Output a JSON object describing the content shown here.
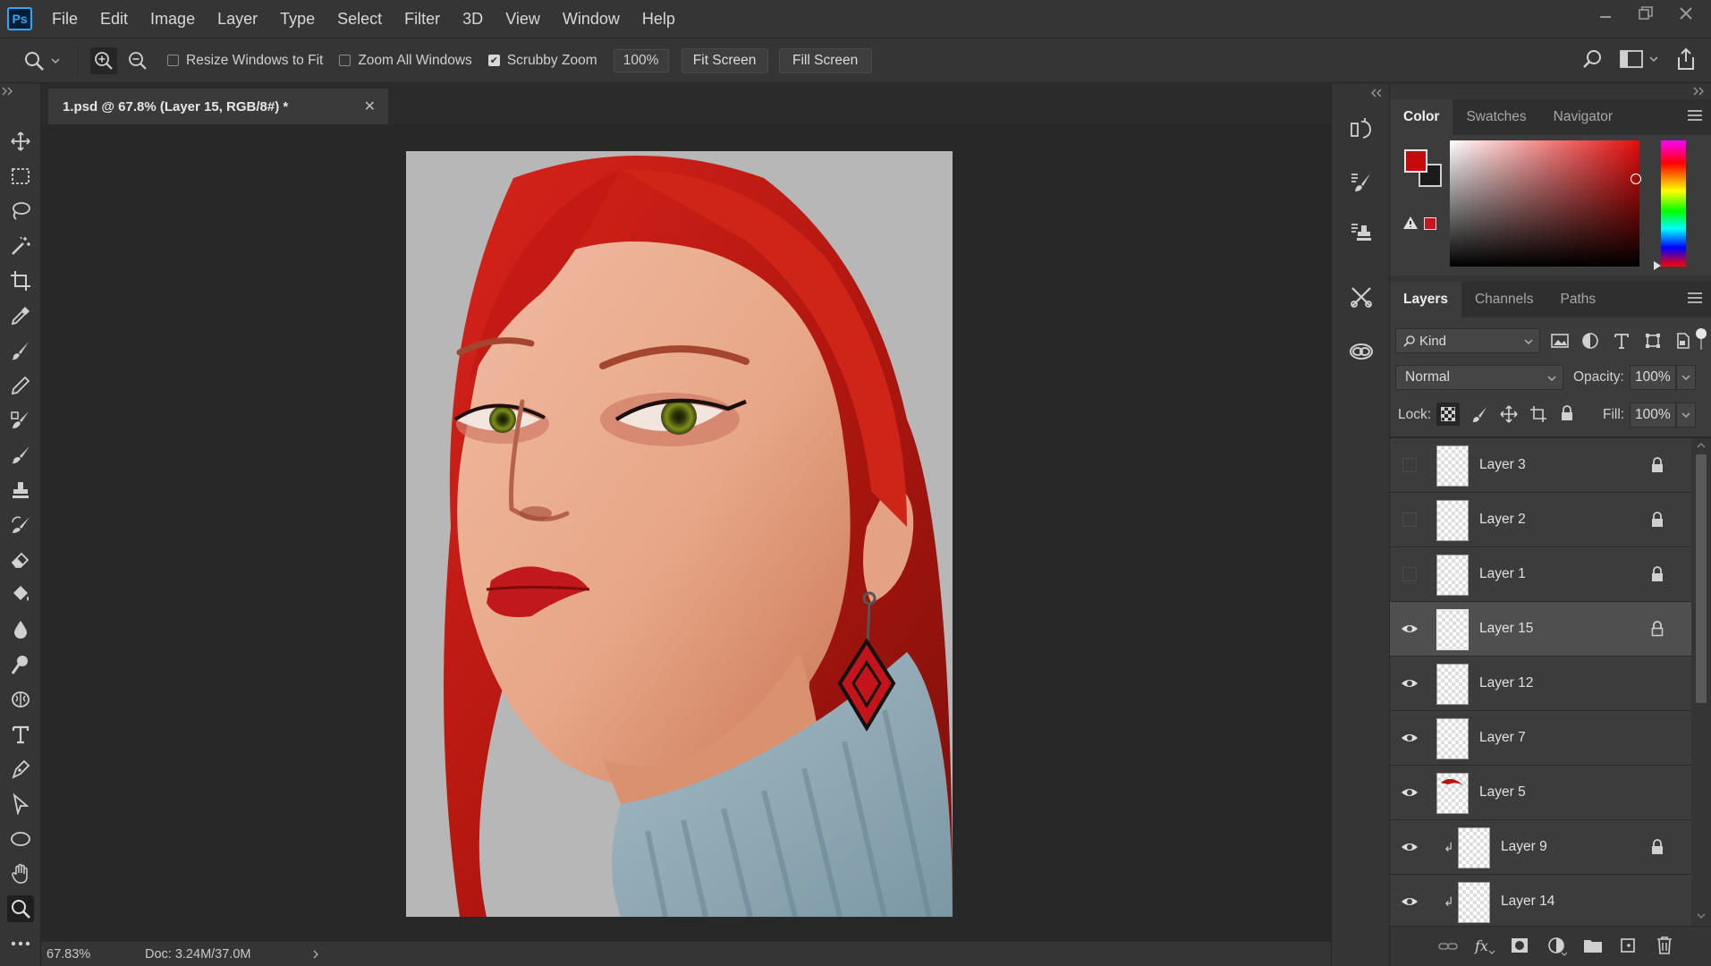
{
  "app": {
    "menu": [
      "File",
      "Edit",
      "Image",
      "Layer",
      "Type",
      "Select",
      "Filter",
      "3D",
      "View",
      "Window",
      "Help"
    ],
    "logo_text": "Ps"
  },
  "options": {
    "resize_windows": "Resize Windows to Fit",
    "zoom_all": "Zoom All Windows",
    "scrubby_zoom": "Scrubby Zoom",
    "zoom_value": "100%",
    "fit_screen": "Fit Screen",
    "fill_screen": "Fill Screen"
  },
  "document": {
    "tab_title": "1.psd @ 67.8% (Layer 15, RGB/8#) *",
    "zoom": "67.83%",
    "doc_size": "Doc: 3.24M/37.0M"
  },
  "color_panel": {
    "tabs": [
      "Color",
      "Swatches",
      "Navigator"
    ],
    "foreground": "#c40c0c",
    "background": "#1b1b1b"
  },
  "layers_panel": {
    "tabs": [
      "Layers",
      "Channels",
      "Paths"
    ],
    "filter_kind": "Kind",
    "blend_mode": "Normal",
    "opacity_label": "Opacity:",
    "opacity_value": "100%",
    "lock_label": "Lock:",
    "fill_label": "Fill:",
    "fill_value": "100%",
    "layers": [
      {
        "name": "Layer 3",
        "visible": false,
        "locked": true,
        "selected": false,
        "clipped": false
      },
      {
        "name": "Layer 2",
        "visible": false,
        "locked": true,
        "selected": false,
        "clipped": false
      },
      {
        "name": "Layer 1",
        "visible": false,
        "locked": true,
        "selected": false,
        "clipped": false
      },
      {
        "name": "Layer 15",
        "visible": true,
        "locked": true,
        "selected": true,
        "clipped": false
      },
      {
        "name": "Layer 12",
        "visible": true,
        "locked": false,
        "selected": false,
        "clipped": false
      },
      {
        "name": "Layer 7",
        "visible": true,
        "locked": false,
        "selected": false,
        "clipped": false
      },
      {
        "name": "Layer 5",
        "visible": true,
        "locked": false,
        "selected": false,
        "clipped": false
      },
      {
        "name": "Layer 9",
        "visible": true,
        "locked": true,
        "selected": false,
        "clipped": true
      },
      {
        "name": "Layer 14",
        "visible": true,
        "locked": false,
        "selected": false,
        "clipped": true
      }
    ]
  }
}
